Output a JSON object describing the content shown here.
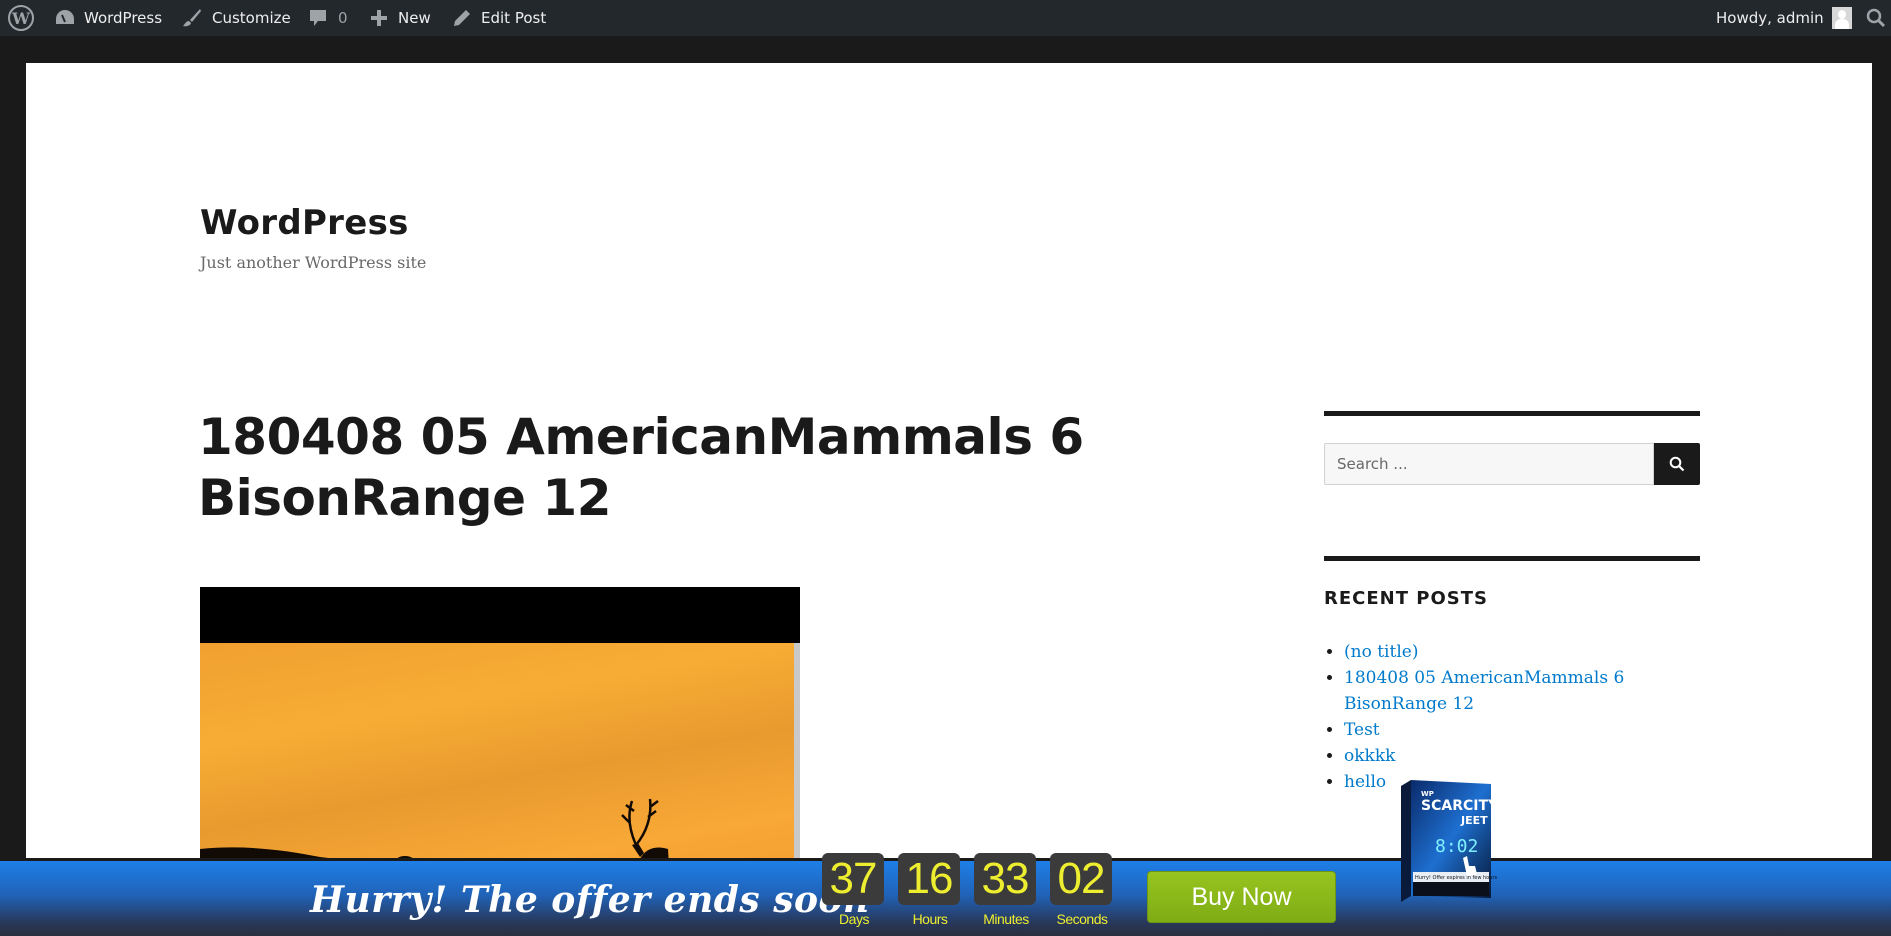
{
  "admin_bar": {
    "wp_logo": "wordpress-logo-icon",
    "site_name": "WordPress",
    "customize": "Customize",
    "comments_count": "0",
    "new": "New",
    "edit_post": "Edit Post",
    "howdy": "Howdy, admin",
    "search_icon": "search-icon"
  },
  "header": {
    "site_title": "WordPress",
    "site_description": "Just another WordPress site"
  },
  "post": {
    "title": "180408 05 AmericanMammals 6 BisonRange 12",
    "image_alt": "Elk silhouette at sunset"
  },
  "sidebar": {
    "search": {
      "placeholder": "Search ...",
      "value": ""
    },
    "recent_posts": {
      "title": "RECENT POSTS",
      "items": [
        {
          "label": "(no title)"
        },
        {
          "label": "180408 05 AmericanMammals 6 BisonRange 12"
        },
        {
          "label": "Test"
        },
        {
          "label": "okkkk"
        },
        {
          "label": "hello"
        }
      ]
    }
  },
  "offer_bar": {
    "headline": "Hurry! The offer ends soon",
    "countdown": [
      {
        "value": "37",
        "label": "Days"
      },
      {
        "value": "16",
        "label": "Hours"
      },
      {
        "value": "33",
        "label": "Minutes"
      },
      {
        "value": "02",
        "label": "Seconds"
      }
    ],
    "buy_label": "Buy Now",
    "product_box": {
      "brand": "WP SCARCITY JEET",
      "clock": "8:02",
      "tagline": "Hurry! Offer expires in few hours!"
    }
  },
  "colors": {
    "admin_bar_bg": "#23282d",
    "link": "#007acc",
    "countdown_digit": "#eeee30",
    "buy_button": "#8bb81a",
    "offer_bar_top": "#1e7fe8"
  }
}
